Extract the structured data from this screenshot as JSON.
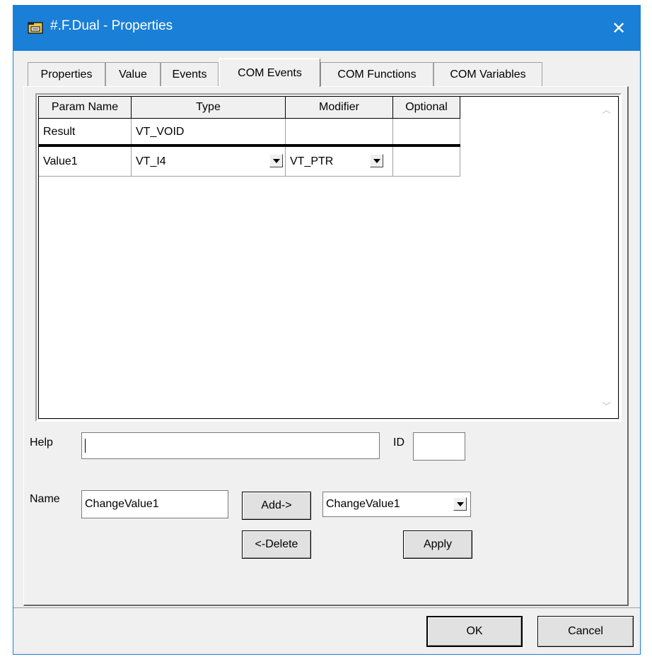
{
  "window": {
    "title": "#.F.Dual - Properties",
    "close_glyph": "✕",
    "title_icon": "folder-properties-icon"
  },
  "tabs": [
    {
      "label": "Properties"
    },
    {
      "label": "Value"
    },
    {
      "label": "Events"
    },
    {
      "label": "COM Events",
      "active": true
    },
    {
      "label": "COM Functions"
    },
    {
      "label": "COM Variables"
    }
  ],
  "grid": {
    "headers": [
      "Param Name",
      "Type",
      "Modifier",
      "Optional"
    ],
    "rows": [
      {
        "param_name": "Result",
        "type": "VT_VOID",
        "modifier": "",
        "optional": ""
      },
      {
        "param_name": "Value1",
        "type": "VT_I4",
        "modifier": "VT_PTR",
        "optional": ""
      }
    ]
  },
  "form": {
    "help_label": "Help",
    "help_value": "",
    "id_label": "ID",
    "id_value": "",
    "name_label": "Name",
    "name_value": "ChangeValue1",
    "add_label": "Add->",
    "delete_label": "<-Delete",
    "event_select_value": "ChangeValue1",
    "apply_label": "Apply"
  },
  "footer": {
    "ok_label": "OK",
    "cancel_label": "Cancel"
  },
  "colors": {
    "titlebar": "#1a7fd6",
    "dialog": "#f0f0f0"
  }
}
